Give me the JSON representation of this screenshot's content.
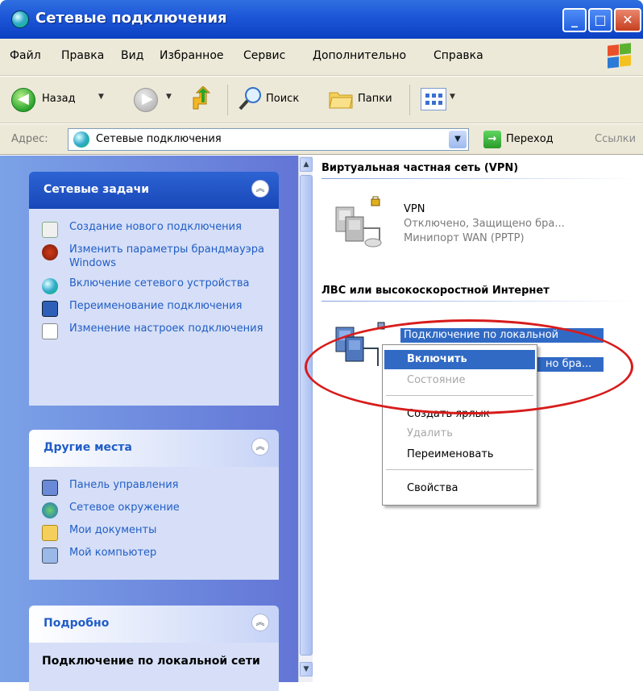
{
  "window": {
    "title": "Сетевые подключения",
    "controls": {
      "minimize": "_",
      "maximize": "□",
      "close": "✕"
    }
  },
  "menu": [
    "Файл",
    "Правка",
    "Вид",
    "Избранное",
    "Сервис",
    "Дополнительно",
    "Справка"
  ],
  "toolbar": {
    "back_label": "Назад",
    "search_label": "Поиск",
    "folders_label": "Папки"
  },
  "address": {
    "label": "Адрес:",
    "value": "Сетевые подключения",
    "go_label": "Переход",
    "links_label": "Ссылки"
  },
  "sidebar": {
    "network_tasks": {
      "title": "Сетевые задачи",
      "items": [
        {
          "label": "Создание нового подключения",
          "icon": "new-connection-icon"
        },
        {
          "label": "Изменить параметры брандмауэра Windows",
          "icon": "firewall-icon"
        },
        {
          "label": "Включение сетевого устройства",
          "icon": "enable-device-icon"
        },
        {
          "label": "Переименование подключения",
          "icon": "rename-icon"
        },
        {
          "label": "Изменение настроек подключения",
          "icon": "settings-icon"
        }
      ]
    },
    "other_places": {
      "title": "Другие места",
      "items": [
        {
          "label": "Панель управления",
          "icon": "control-panel-icon"
        },
        {
          "label": "Сетевое окружение",
          "icon": "network-places-icon"
        },
        {
          "label": "Мои документы",
          "icon": "my-documents-icon"
        },
        {
          "label": "Мой компьютер",
          "icon": "my-computer-icon"
        }
      ]
    },
    "details": {
      "title": "Подробно",
      "text": "Подключение по локальной сети"
    }
  },
  "content": {
    "vpn_group": {
      "title": "Виртуальная частная сеть (VPN)",
      "connection": {
        "name": "VPN",
        "status": "Отключено, Защищено бра...",
        "device": "Минипорт WAN (PPTP)"
      }
    },
    "lan_group": {
      "title": "ЛВС или высокоскоростной Интернет",
      "connection": {
        "name": "Подключение по локальной",
        "status_tail": "но бра..."
      }
    }
  },
  "context_menu": {
    "items": [
      {
        "label": "Включить",
        "state": "highlighted"
      },
      {
        "label": "Состояние",
        "state": "disabled"
      },
      {
        "label": "Создать ярлык",
        "state": "normal"
      },
      {
        "label": "Удалить",
        "state": "disabled"
      },
      {
        "label": "Переименовать",
        "state": "normal"
      },
      {
        "label": "Свойства",
        "state": "normal"
      }
    ]
  },
  "colors": {
    "title_bar": "#0b40c2",
    "highlight": "#316ac5",
    "annotation": "#d81b1b",
    "taskpane": "#6375d6"
  }
}
